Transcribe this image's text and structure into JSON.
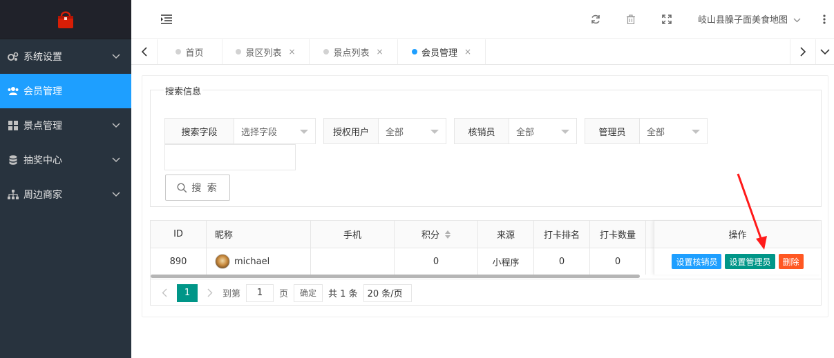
{
  "sidebar": {
    "items": [
      {
        "label": "系统设置",
        "icon": "gears-icon"
      },
      {
        "label": "会员管理",
        "icon": "users-icon",
        "active": true
      },
      {
        "label": "景点管理",
        "icon": "grid-icon"
      },
      {
        "label": "抽奖中心",
        "icon": "database-icon"
      },
      {
        "label": "周边商家",
        "icon": "sitemap-icon"
      }
    ]
  },
  "header": {
    "site_name": "岐山县臊子面美食地图"
  },
  "tabs": [
    {
      "label": "首页"
    },
    {
      "label": "景区列表",
      "close": "×"
    },
    {
      "label": "景点列表",
      "close": "×"
    },
    {
      "label": "会员管理",
      "close": "×",
      "active": true
    }
  ],
  "search": {
    "legend": "搜索信息",
    "filters": [
      {
        "label": "搜索字段",
        "value": "选择字段"
      },
      {
        "label": "授权用户",
        "value": "全部"
      },
      {
        "label": "核销员",
        "value": "全部"
      },
      {
        "label": "管理员",
        "value": "全部"
      }
    ],
    "button_label": "搜 索"
  },
  "table": {
    "columns": [
      "ID",
      "昵称",
      "手机",
      "积分",
      "来源",
      "打卡排名",
      "打卡数量",
      "操作"
    ],
    "rows": [
      {
        "id": "890",
        "nickname": "michael",
        "phone": "",
        "points": "0",
        "source": "小程序",
        "rank": "0",
        "count": "0"
      }
    ],
    "actions": {
      "set_verifier": "设置核销员",
      "set_admin": "设置管理员",
      "delete": "删除"
    }
  },
  "pager": {
    "current": "1",
    "goto_label": "到第",
    "goto_value": "1",
    "page_unit": "页",
    "confirm": "确定",
    "total": "共 1 条",
    "page_size": "20 条/页"
  },
  "colors": {
    "accent": "#1e9fff",
    "green": "#009688",
    "danger": "#ff5722",
    "sidebar_bg": "#28333e",
    "arrow": "#ff1a1a"
  }
}
